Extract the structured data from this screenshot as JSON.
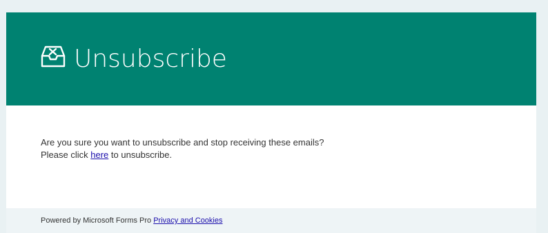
{
  "header": {
    "icon": "unsubscribe-inbox-icon",
    "title": "Unsubscribe"
  },
  "message": {
    "line1": "Are you sure you want to unsubscribe and stop receiving these emails?",
    "line2_prefix": "Please click",
    "link_text": "here",
    "line2_suffix": "to unsubscribe."
  },
  "footer": {
    "powered_by": "Powered by Microsoft Forms Pro",
    "privacy_link": "Privacy and Cookies"
  },
  "colors": {
    "header_bg": "#008271",
    "page_bg": "#e9f1f3",
    "link": "#1a0dab"
  }
}
